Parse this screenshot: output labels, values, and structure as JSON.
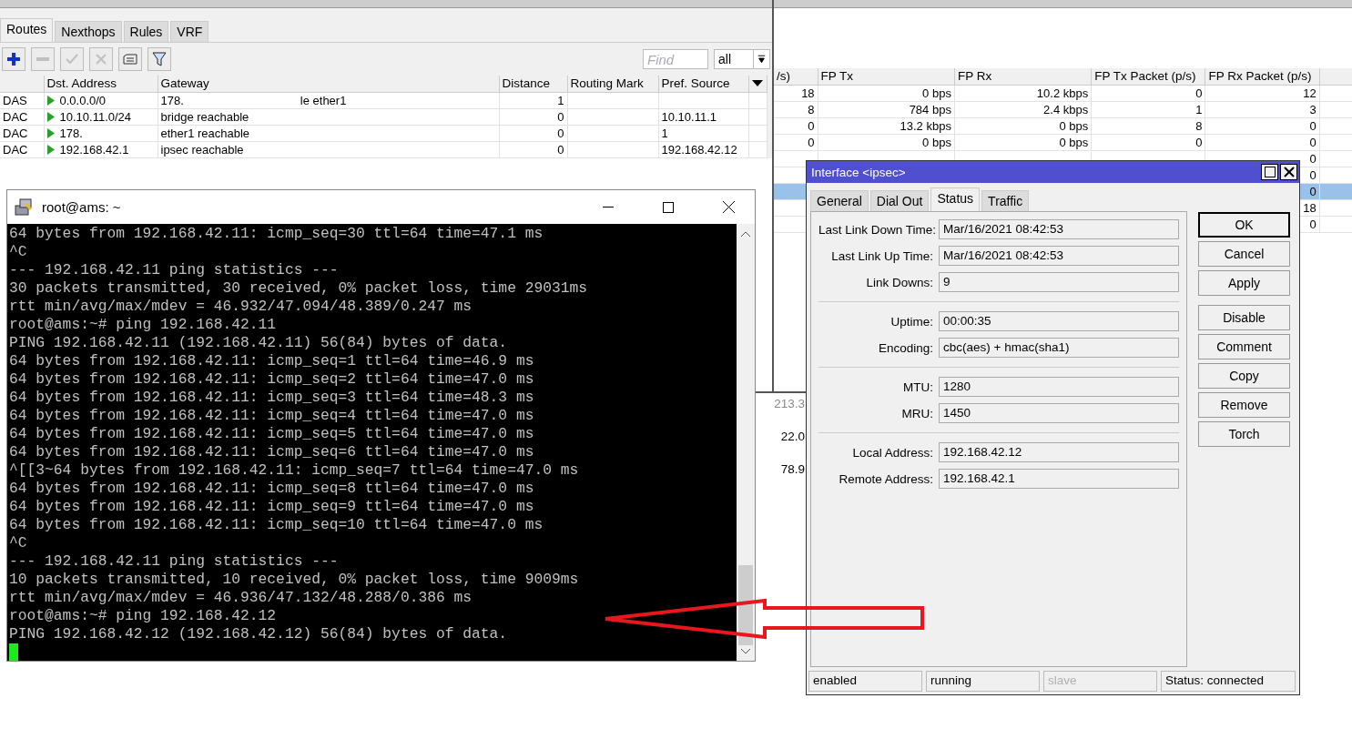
{
  "route_list": {
    "tabs": [
      {
        "label": "Routes",
        "selected": true
      },
      {
        "label": "Nexthops",
        "selected": false
      },
      {
        "label": "Rules",
        "selected": false
      },
      {
        "label": "VRF",
        "selected": false
      }
    ],
    "toolbar": [
      {
        "kind": "add",
        "disabled": false
      },
      {
        "kind": "remove",
        "disabled": true
      },
      {
        "kind": "enable",
        "disabled": true
      },
      {
        "kind": "disable",
        "disabled": true
      },
      {
        "kind": "comment",
        "disabled": false
      },
      {
        "kind": "filter",
        "disabled": false
      }
    ],
    "find": {
      "placeholder": "Find"
    },
    "filter_value": "all",
    "columns": [
      "",
      "Dst. Address",
      "Gateway",
      "Distance",
      "Routing Mark",
      "Pref. Source"
    ],
    "rows": [
      {
        "flags": "DAS",
        "dst": "0.0.0.0/0",
        "gateway": [
          "178.",
          "le ether1"
        ],
        "distance": "1",
        "routing_mark": "",
        "pref_source": ""
      },
      {
        "flags": "DAC",
        "dst": "10.10.11.0/24",
        "gateway": [
          "bridge reachable"
        ],
        "distance": "0",
        "routing_mark": "",
        "pref_source": "10.10.11.1"
      },
      {
        "flags": "DAC",
        "dst": "178.",
        "gateway": [
          "ether1 reachable"
        ],
        "distance": "0",
        "routing_mark": "",
        "pref_source": "1"
      },
      {
        "flags": "DAC",
        "dst": "192.168.42.1",
        "gateway": [
          "ipsec reachable"
        ],
        "distance": "0",
        "routing_mark": "",
        "pref_source": "192.168.42.12"
      }
    ]
  },
  "interface_list": {
    "columns": [
      "/s)",
      "FP Tx",
      "FP Rx",
      "FP Tx Packet (p/s)",
      "FP Rx Packet (p/s)"
    ],
    "rows": [
      {
        "selected": false,
        "cells": [
          "18",
          "0 bps",
          "10.2 kbps",
          "0",
          "12"
        ]
      },
      {
        "selected": false,
        "cells": [
          "8",
          "784 bps",
          "2.4 kbps",
          "1",
          "3"
        ]
      },
      {
        "selected": false,
        "cells": [
          "0",
          "13.2 kbps",
          "0 bps",
          "8",
          "0"
        ]
      },
      {
        "selected": false,
        "cells": [
          "0",
          "0 bps",
          "0 bps",
          "0",
          "0"
        ]
      },
      {
        "selected": false,
        "cells": [
          "",
          "",
          "",
          "",
          "0"
        ]
      },
      {
        "selected": false,
        "cells": [
          "",
          "",
          "",
          "",
          "0"
        ]
      },
      {
        "selected": true,
        "cells": [
          "",
          "",
          "",
          "",
          "0"
        ]
      },
      {
        "selected": false,
        "cells": [
          "",
          "",
          "",
          "",
          "18"
        ]
      },
      {
        "selected": false,
        "cells": [
          "",
          "",
          "",
          "",
          "0"
        ]
      }
    ]
  },
  "traffic_panel": {
    "values": [
      {
        "text": "213.3",
        "dim": true
      },
      {
        "text": "22.0",
        "dim": false
      },
      {
        "text": "78.9",
        "dim": false
      }
    ]
  },
  "terminal": {
    "title": "root@ams: ~",
    "lines": [
      "64 bytes from 192.168.42.11: icmp_seq=30 ttl=64 time=47.1 ms",
      "^C",
      "--- 192.168.42.11 ping statistics ---",
      "30 packets transmitted, 30 received, 0% packet loss, time 29031ms",
      "rtt min/avg/max/mdev = 46.932/47.094/48.389/0.247 ms",
      "root@ams:~# ping 192.168.42.11",
      "PING 192.168.42.11 (192.168.42.11) 56(84) bytes of data.",
      "64 bytes from 192.168.42.11: icmp_seq=1 ttl=64 time=46.9 ms",
      "64 bytes from 192.168.42.11: icmp_seq=2 ttl=64 time=47.0 ms",
      "64 bytes from 192.168.42.11: icmp_seq=3 ttl=64 time=48.3 ms",
      "64 bytes from 192.168.42.11: icmp_seq=4 ttl=64 time=47.0 ms",
      "64 bytes from 192.168.42.11: icmp_seq=5 ttl=64 time=47.0 ms",
      "64 bytes from 192.168.42.11: icmp_seq=6 ttl=64 time=47.0 ms",
      "^[[3~64 bytes from 192.168.42.11: icmp_seq=7 ttl=64 time=47.0 ms",
      "64 bytes from 192.168.42.11: icmp_seq=8 ttl=64 time=47.0 ms",
      "64 bytes from 192.168.42.11: icmp_seq=9 ttl=64 time=47.0 ms",
      "64 bytes from 192.168.42.11: icmp_seq=10 ttl=64 time=47.0 ms",
      "^C",
      "--- 192.168.42.11 ping statistics ---",
      "10 packets transmitted, 10 received, 0% packet loss, time 9009ms",
      "rtt min/avg/max/mdev = 46.936/47.132/48.288/0.386 ms",
      "root@ams:~# ping 192.168.42.12",
      "PING 192.168.42.12 (192.168.42.12) 56(84) bytes of data."
    ]
  },
  "dialog": {
    "title": "Interface <ipsec>",
    "tabs": [
      {
        "label": "General",
        "selected": false
      },
      {
        "label": "Dial Out",
        "selected": false
      },
      {
        "label": "Status",
        "selected": true
      },
      {
        "label": "Traffic",
        "selected": false
      }
    ],
    "groups": [
      {
        "fields": [
          {
            "label": "Last Link Down Time:",
            "value": "Mar/16/2021 08:42:53"
          },
          {
            "label": "Last Link Up Time:",
            "value": "Mar/16/2021 08:42:53"
          },
          {
            "label": "Link Downs:",
            "value": "9"
          }
        ]
      },
      {
        "fields": [
          {
            "label": "Uptime:",
            "value": "00:00:35"
          },
          {
            "label": "Encoding:",
            "value": "cbc(aes) + hmac(sha1)"
          }
        ]
      },
      {
        "fields": [
          {
            "label": "MTU:",
            "value": "1280"
          },
          {
            "label": "MRU:",
            "value": "1450"
          }
        ]
      },
      {
        "fields": [
          {
            "label": "Local Address:",
            "value": "192.168.42.12"
          },
          {
            "label": "Remote Address:",
            "value": "192.168.42.1"
          }
        ]
      }
    ],
    "button_groups": [
      [
        {
          "label": "OK",
          "default": true
        },
        {
          "label": "Cancel",
          "default": false
        },
        {
          "label": "Apply",
          "default": false
        }
      ],
      [
        {
          "label": "Disable",
          "default": false
        },
        {
          "label": "Comment",
          "default": false
        },
        {
          "label": "Copy",
          "default": false
        },
        {
          "label": "Remove",
          "default": false
        },
        {
          "label": "Torch",
          "default": false
        }
      ]
    ],
    "status_bar": [
      {
        "text": "enabled",
        "disabled": false
      },
      {
        "text": "running",
        "disabled": false
      },
      {
        "text": "slave",
        "disabled": true
      },
      {
        "text": "Status: connected",
        "disabled": false
      }
    ]
  }
}
